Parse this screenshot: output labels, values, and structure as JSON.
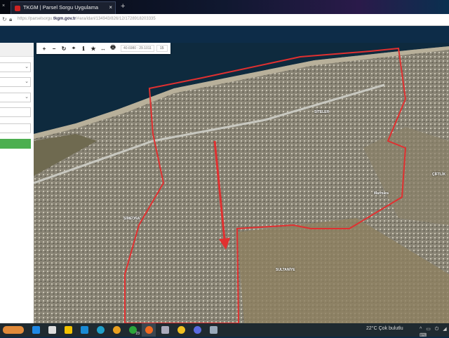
{
  "browser": {
    "tab_title": "TKGM | Parsel Sorgu Uygulama",
    "url_prefix": "https://parselsorgu.",
    "url_domain": "tkgm.gov.tr",
    "url_path": "/#ara/idari/134943/826/12/1728918203335",
    "close": "×",
    "new_tab": "+"
  },
  "map": {
    "toolbar": {
      "zoom_in": "+",
      "zoom_out": "−",
      "refresh": "↻",
      "locate": "⌖",
      "info": "ℹ",
      "favorite": "★",
      "measure": "↔",
      "print": "🖶",
      "coordinates": "40.6980 : 29.1011",
      "zoom_level": "15"
    },
    "labels": [
      "SİTELER",
      "ÇİFTLİK",
      "SİMEONA",
      "SULTANİYE",
      "Marmara"
    ],
    "boundary_color": "#e03030"
  },
  "taskbar": {
    "weather": "22°C  Çok bulutlu",
    "notification_count": "23",
    "tray": "^ ▭ ⏻ ◢ ⌨"
  }
}
